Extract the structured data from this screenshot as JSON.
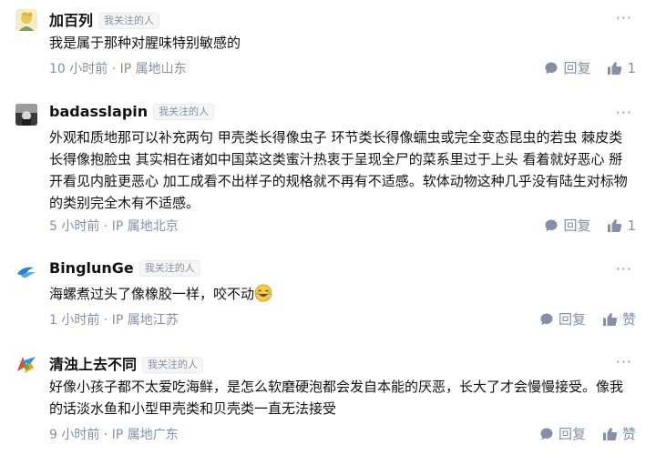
{
  "comments": [
    {
      "author": "加百列",
      "tag": "我关注的人",
      "text": "我是属于那种对腥味特别敏感的",
      "meta": "10 小时前 · IP 属地山东",
      "reply_label": "回复",
      "like_label": "1",
      "more_label": "···"
    },
    {
      "author": "badasslapin",
      "tag": "我关注的人",
      "text": "外观和质地那可以补充两句 甲壳类长得像虫子 环节类长得像蠕虫或完全变态昆虫的若虫 棘皮类长得像抱脸虫 其实相在诸如中国菜这类蜜汁热衷于呈现全尸的菜系里过于上头 看着就好恶心 掰开看见内脏更恶心 加工成看不出样子的规格就不再有不适感。软体动物这种几乎没有陆生对标物的类别完全木有不适感。",
      "meta": "5 小时前 · IP 属地北京",
      "reply_label": "回复",
      "like_label": "1",
      "more_label": "···"
    },
    {
      "author": "BinglunGe",
      "tag": "我关注的人",
      "text": "海螺煮过头了像橡胶一样，咬不动",
      "meta": "1 小时前 · IP 属地江苏",
      "reply_label": "回复",
      "like_label": "赞",
      "more_label": "···"
    },
    {
      "author": "清浊上去不同",
      "tag": "我关注的人",
      "text": "好像小孩子都不太爱吃海鲜，是怎么软磨硬泡都会发自本能的厌恶，长大了才会慢慢接受。像我的话淡水鱼和小型甲壳类和贝壳类一直无法接受",
      "meta": "9 小时前 · IP 属地广东",
      "reply_label": "回复",
      "like_label": "赞",
      "more_label": "···"
    }
  ],
  "colors": {
    "text": "#121212",
    "meta": "#8590a6",
    "tag_bg": "#f6f6f6"
  },
  "icons": [
    "comment-bubble-icon",
    "thumbs-up-icon",
    "more-dots-icon",
    "laughing-emoji-icon"
  ]
}
